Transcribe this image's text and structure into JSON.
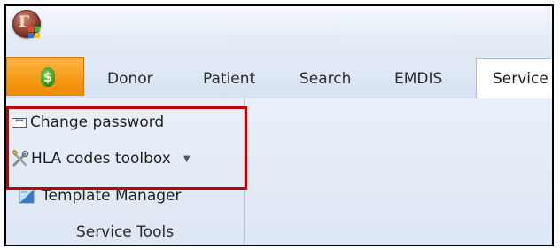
{
  "tabs": {
    "file_icon": "green-s-orb-icon",
    "donor": "Donor",
    "patient": "Patient",
    "search": "Search",
    "emdis": "EMDIS",
    "service": "Service"
  },
  "commands": {
    "change_password": "Change password",
    "hla_toolbox": "HLA codes toolbox",
    "template_manager": "Template Manager"
  },
  "group": {
    "label": "Service Tools"
  },
  "colors": {
    "file_tab": "#f59a12",
    "highlight_border": "#c00000",
    "ribbon_bg": "#dde7f4"
  }
}
